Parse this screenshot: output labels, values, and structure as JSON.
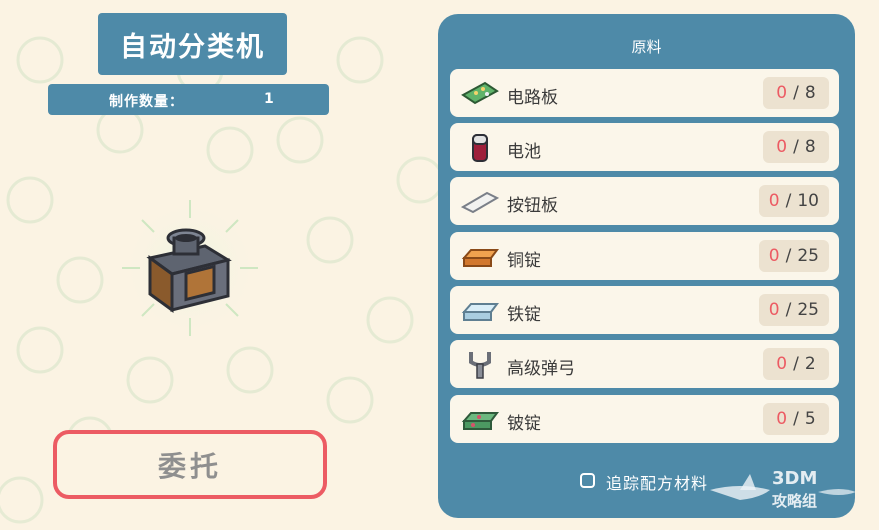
{
  "recipe": {
    "title": "自动分类机",
    "quantity_label": "制作数量：",
    "quantity_value": "1",
    "entrust_label": "委托"
  },
  "materials": {
    "title": "原料",
    "items": [
      {
        "name": "电路板",
        "have": "0",
        "sep": "/",
        "need": "8",
        "icon": "circuit-board-icon"
      },
      {
        "name": "电池",
        "have": "0",
        "sep": "/",
        "need": "8",
        "icon": "battery-icon"
      },
      {
        "name": "按钮板",
        "have": "0",
        "sep": "/",
        "need": "10",
        "icon": "button-panel-icon"
      },
      {
        "name": "铜锭",
        "have": "0",
        "sep": "/",
        "need": "25",
        "icon": "copper-ingot-icon"
      },
      {
        "name": "铁锭",
        "have": "0",
        "sep": "/",
        "need": "25",
        "icon": "iron-ingot-icon"
      },
      {
        "name": "高级弹弓",
        "have": "0",
        "sep": "/",
        "need": "2",
        "icon": "advanced-slingshot-icon"
      },
      {
        "name": "铍锭",
        "have": "0",
        "sep": "/",
        "need": "5",
        "icon": "beryllium-ingot-icon"
      }
    ],
    "track_label": "追踪配方材料"
  },
  "watermark": {
    "line1": "3DM",
    "line2": "攻略组"
  },
  "colors": {
    "background": "#fbf3e3",
    "panel": "#4e8aa8",
    "accent_red": "#ec5b63",
    "row_bg": "#fbf6ea",
    "count_bg": "#ece2d0"
  }
}
